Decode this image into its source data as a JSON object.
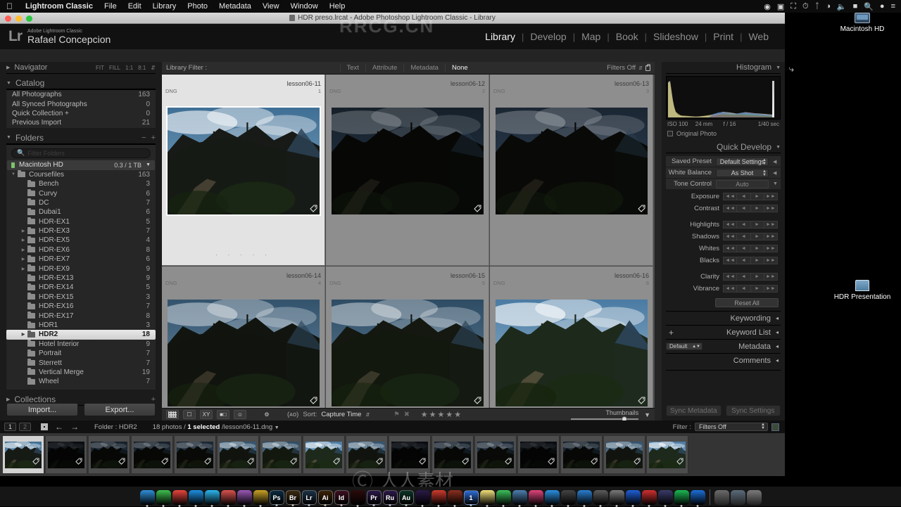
{
  "menubar": {
    "apple_icon": "apple-icon",
    "items": [
      "Lightroom Classic",
      "File",
      "Edit",
      "Library",
      "Photo",
      "Metadata",
      "View",
      "Window",
      "Help"
    ],
    "status_icons": [
      "screenrecord-icon",
      "display-icon",
      "airplay-icon",
      "timemachine-icon",
      "bluetooth-icon",
      "wifi-icon",
      "volume-icon",
      "battery-icon",
      "search-icon",
      "siri-icon",
      "controlcenter-icon"
    ]
  },
  "desktop": {
    "icons": [
      {
        "label": "Macintosh HD",
        "glyph": "harddisk-icon"
      },
      {
        "label": "HDR Presentation",
        "glyph": "presentation-folder-icon"
      }
    ]
  },
  "window": {
    "title": "HDR preso.lrcat - Adobe Photoshop Lightroom Classic - Library",
    "doc_icon": "document-icon"
  },
  "identity": {
    "logo": "Lr",
    "line1": "Adobe Lightroom Classic",
    "line2": "Rafael Concepcion"
  },
  "modules": {
    "items": [
      "Library",
      "Develop",
      "Map",
      "Book",
      "Slideshow",
      "Print",
      "Web"
    ],
    "active": "Library"
  },
  "navigator": {
    "title": "Navigator",
    "zoom_options": [
      "FIT",
      "FILL",
      "1:1",
      "8:1"
    ],
    "chevron": "chevron-updown-icon"
  },
  "catalog": {
    "title": "Catalog",
    "items": [
      {
        "label": "All Photographs",
        "count": "163"
      },
      {
        "label": "All Synced Photographs",
        "count": "0"
      },
      {
        "label": "Quick Collection  +",
        "count": "0"
      },
      {
        "label": "Previous Import",
        "count": "21"
      }
    ]
  },
  "folders": {
    "title": "Folders",
    "minus": "−",
    "plus": "+",
    "search_placeholder": "Filter Folders",
    "volume": {
      "name": "Macintosh HD",
      "capacity": "0.3 / 1 TB"
    },
    "items": [
      {
        "label": "Coursefiles",
        "count": "163",
        "indent": 0,
        "disclosure": "open",
        "selected": false
      },
      {
        "label": "Bench",
        "count": "3",
        "indent": 1,
        "disclosure": "none",
        "selected": false
      },
      {
        "label": "Curvy",
        "count": "6",
        "indent": 1,
        "disclosure": "none",
        "selected": false
      },
      {
        "label": "DC",
        "count": "7",
        "indent": 1,
        "disclosure": "none",
        "selected": false
      },
      {
        "label": "Dubai1",
        "count": "6",
        "indent": 1,
        "disclosure": "none",
        "selected": false
      },
      {
        "label": "HDR-EX1",
        "count": "5",
        "indent": 1,
        "disclosure": "none",
        "selected": false
      },
      {
        "label": "HDR-EX3",
        "count": "7",
        "indent": 1,
        "disclosure": "closed",
        "selected": false
      },
      {
        "label": "HDR-EX5",
        "count": "4",
        "indent": 1,
        "disclosure": "closed",
        "selected": false
      },
      {
        "label": "HDR-EX6",
        "count": "8",
        "indent": 1,
        "disclosure": "closed",
        "selected": false
      },
      {
        "label": "HDR-EX7",
        "count": "6",
        "indent": 1,
        "disclosure": "closed",
        "selected": false
      },
      {
        "label": "HDR-EX9",
        "count": "9",
        "indent": 1,
        "disclosure": "closed",
        "selected": false
      },
      {
        "label": "HDR-EX13",
        "count": "9",
        "indent": 1,
        "disclosure": "none",
        "selected": false
      },
      {
        "label": "HDR-EX14",
        "count": "5",
        "indent": 1,
        "disclosure": "none",
        "selected": false
      },
      {
        "label": "HDR-EX15",
        "count": "3",
        "indent": 1,
        "disclosure": "none",
        "selected": false
      },
      {
        "label": "HDR-EX16",
        "count": "7",
        "indent": 1,
        "disclosure": "none",
        "selected": false
      },
      {
        "label": "HDR-EX17",
        "count": "8",
        "indent": 1,
        "disclosure": "none",
        "selected": false
      },
      {
        "label": "HDR1",
        "count": "3",
        "indent": 1,
        "disclosure": "none",
        "selected": false
      },
      {
        "label": "HDR2",
        "count": "18",
        "indent": 1,
        "disclosure": "closed",
        "selected": true
      },
      {
        "label": "Hotel Interior",
        "count": "9",
        "indent": 1,
        "disclosure": "none",
        "selected": false
      },
      {
        "label": "Portrait",
        "count": "7",
        "indent": 1,
        "disclosure": "none",
        "selected": false
      },
      {
        "label": "Sterrett",
        "count": "7",
        "indent": 1,
        "disclosure": "none",
        "selected": false
      },
      {
        "label": "Vertical Merge",
        "count": "19",
        "indent": 1,
        "disclosure": "none",
        "selected": false
      },
      {
        "label": "Wheel",
        "count": "7",
        "indent": 1,
        "disclosure": "none",
        "selected": false
      }
    ]
  },
  "collections": {
    "title": "Collections",
    "plus": "+"
  },
  "left_buttons": {
    "import": "Import...",
    "export": "Export..."
  },
  "library_filter": {
    "label": "Library Filter :",
    "options": [
      "Text",
      "Attribute",
      "Metadata",
      "None"
    ],
    "active": "None",
    "filters_off": "Filters Off",
    "lock_icon": "lock-icon"
  },
  "histogram": {
    "title": "Histogram",
    "iso": "ISO 100",
    "focal": "24 mm",
    "aperture": "f / 16",
    "shutter": "1/40 sec",
    "original_photo": "Original Photo"
  },
  "quick_develop": {
    "title": "Quick Develop",
    "saved_preset": {
      "label": "Saved Preset",
      "value": "Default Settings"
    },
    "white_balance": {
      "label": "White Balance",
      "value": "As Shot"
    },
    "tone_control": {
      "label": "Tone Control",
      "value": "Auto"
    },
    "sliders": [
      "Exposure",
      "Contrast",
      "Highlights",
      "Shadows",
      "Whites",
      "Blacks",
      "Clarity",
      "Vibrance"
    ],
    "step_labels": [
      "◄◄",
      "◄",
      "►",
      "►►"
    ],
    "reset_all": "Reset All"
  },
  "right_panels": [
    {
      "title": "Keywording",
      "has_plus": false,
      "has_select": false
    },
    {
      "title": "Keyword List",
      "has_plus": true,
      "has_select": false
    },
    {
      "title": "Metadata",
      "has_plus": false,
      "has_select": true,
      "select_value": "Default"
    },
    {
      "title": "Comments",
      "has_plus": false,
      "has_select": false
    }
  ],
  "sync_buttons": {
    "metadata": "Sync Metadata",
    "settings": "Sync Settings"
  },
  "grid": {
    "cells": [
      {
        "name": "lesson06-11",
        "format": "DNG",
        "index": "1",
        "selected": true,
        "variant": "bright"
      },
      {
        "name": "lesson06-12",
        "format": "DNG",
        "index": "2",
        "selected": false,
        "variant": "dark"
      },
      {
        "name": "lesson06-13",
        "format": "DNG",
        "index": "3",
        "selected": false,
        "variant": "dark2"
      },
      {
        "name": "lesson06-14",
        "format": "DNG",
        "index": "4",
        "selected": false,
        "variant": "mid"
      },
      {
        "name": "lesson06-15",
        "format": "DNG",
        "index": "5",
        "selected": false,
        "variant": "mid2"
      },
      {
        "name": "lesson06-16",
        "format": "DNG",
        "index": "6",
        "selected": false,
        "variant": "bright2"
      }
    ],
    "dots": "· · · · ·",
    "badge_icon": "develop-badge-icon"
  },
  "toolbar": {
    "view_icons": [
      "grid-view-icon",
      "loupe-view-icon",
      "compare-view-icon",
      "survey-view-icon",
      "people-view-icon"
    ],
    "paint_icon": "spray-can-icon",
    "sort_icon": "sort-az-icon",
    "sort_label": "Sort:",
    "sort_value": "Capture Time",
    "flag_icon": "flag-icon",
    "reject_icon": "reject-icon",
    "rating": "★★★★★",
    "thumbnails_label": "Thumbnails",
    "thumbnails_value": 75
  },
  "filmstrip_bar": {
    "monitor1": "1",
    "monitor2": "2",
    "grid_icon": "grid-icon",
    "back_icon": "arrow-left-icon",
    "forward_icon": "arrow-right-icon",
    "folder_label": "Folder : HDR2",
    "photos_total": "18 photos /",
    "photos_selected": "1 selected",
    "photos_file": "/lesson06-11.dng",
    "dropdown_icon": "chevron-down-icon",
    "filter_label": "Filter :",
    "filter_value": "Filters Off",
    "filter_flag_icon": "filter-toggle-icon"
  },
  "filmstrip": {
    "thumbs": [
      {
        "variant": "bright",
        "active": true
      },
      {
        "variant": "black",
        "active": false
      },
      {
        "variant": "dark",
        "active": false
      },
      {
        "variant": "dark",
        "active": false
      },
      {
        "variant": "dark2",
        "active": false
      },
      {
        "variant": "mid",
        "active": false
      },
      {
        "variant": "mid2",
        "active": false
      },
      {
        "variant": "bright2",
        "active": false
      },
      {
        "variant": "mid",
        "active": false
      },
      {
        "variant": "black",
        "active": false
      },
      {
        "variant": "dark",
        "active": false
      },
      {
        "variant": "dark2",
        "active": false
      },
      {
        "variant": "black",
        "active": false
      },
      {
        "variant": "dark",
        "active": false
      },
      {
        "variant": "mid",
        "active": false
      },
      {
        "variant": "bright2",
        "active": false
      }
    ]
  },
  "dock": {
    "items": [
      {
        "name": "finder-icon",
        "label": "",
        "color": "#2f8fd8"
      },
      {
        "name": "messages-icon",
        "label": "",
        "color": "#3ec04f"
      },
      {
        "name": "chrome-icon",
        "label": "",
        "color": "#e8453c"
      },
      {
        "name": "safari-icon",
        "label": "",
        "color": "#1e8fe0"
      },
      {
        "name": "todo-icon",
        "label": "",
        "color": "#2bb7f0"
      },
      {
        "name": "capture-icon",
        "label": "",
        "color": "#d9534f"
      },
      {
        "name": "photos-icon",
        "label": "",
        "color": "#9b59b6"
      },
      {
        "name": "transfer-icon",
        "label": "",
        "color": "#c9a227"
      },
      {
        "name": "photoshop-icon",
        "label": "Ps",
        "color": "#0b2a3f"
      },
      {
        "name": "bridge-icon",
        "label": "Br",
        "color": "#3b2a12"
      },
      {
        "name": "lightroom-icon",
        "label": "Lr",
        "color": "#1d3347"
      },
      {
        "name": "illustrator-icon",
        "label": "Ai",
        "color": "#3b2207"
      },
      {
        "name": "indesign-icon",
        "label": "Id",
        "color": "#3d1021"
      },
      {
        "name": "acrobat-icon",
        "label": "",
        "color": "#2b0b0b"
      },
      {
        "name": "premiere-icon",
        "label": "Pr",
        "color": "#2b1a47"
      },
      {
        "name": "rush-icon",
        "label": "Ru",
        "color": "#2b1a47"
      },
      {
        "name": "audition-icon",
        "label": "Au",
        "color": "#0d3326"
      },
      {
        "name": "aftereffects-icon",
        "label": "",
        "color": "#2b1a47"
      },
      {
        "name": "app-red-icon",
        "label": "",
        "color": "#cf3b2e"
      },
      {
        "name": "app-dark-icon",
        "label": "",
        "color": "#8b2f1f"
      },
      {
        "name": "one-icon",
        "label": "1",
        "color": "#2f6fd8"
      },
      {
        "name": "notes-icon",
        "label": "",
        "color": "#f2e07a"
      },
      {
        "name": "mail-icon",
        "label": "",
        "color": "#3cc05b"
      },
      {
        "name": "ftp-icon",
        "label": "",
        "color": "#4d7fb0"
      },
      {
        "name": "itunes-icon",
        "label": "",
        "color": "#e0457c"
      },
      {
        "name": "appstore-icon",
        "label": "",
        "color": "#2b8fe0"
      },
      {
        "name": "settings-icon",
        "label": "",
        "color": "#444"
      },
      {
        "name": "sharing-icon",
        "label": "",
        "color": "#2a7fd0"
      },
      {
        "name": "camera-icon",
        "label": "",
        "color": "#5c5c5c"
      },
      {
        "name": "compass-icon",
        "label": "",
        "color": "#7a7a7a"
      },
      {
        "name": "blue-app-icon",
        "label": "",
        "color": "#1f5fd8"
      },
      {
        "name": "red-app-icon",
        "label": "",
        "color": "#d03030"
      },
      {
        "name": "gear-app-icon",
        "label": "",
        "color": "#3b3b6b"
      },
      {
        "name": "spotify-icon",
        "label": "",
        "color": "#1db954"
      },
      {
        "name": "browser-icon",
        "label": "",
        "color": "#1d6fd8"
      }
    ],
    "right_items": [
      {
        "name": "downloads-folder-icon",
        "color": "#6b6b6b"
      },
      {
        "name": "screen-folder-icon",
        "color": "#5b6b7b"
      },
      {
        "name": "trash-icon",
        "color": "#7b7b7b"
      }
    ]
  },
  "watermarks": {
    "top": "RRCG.CN",
    "center": "人人素材"
  }
}
